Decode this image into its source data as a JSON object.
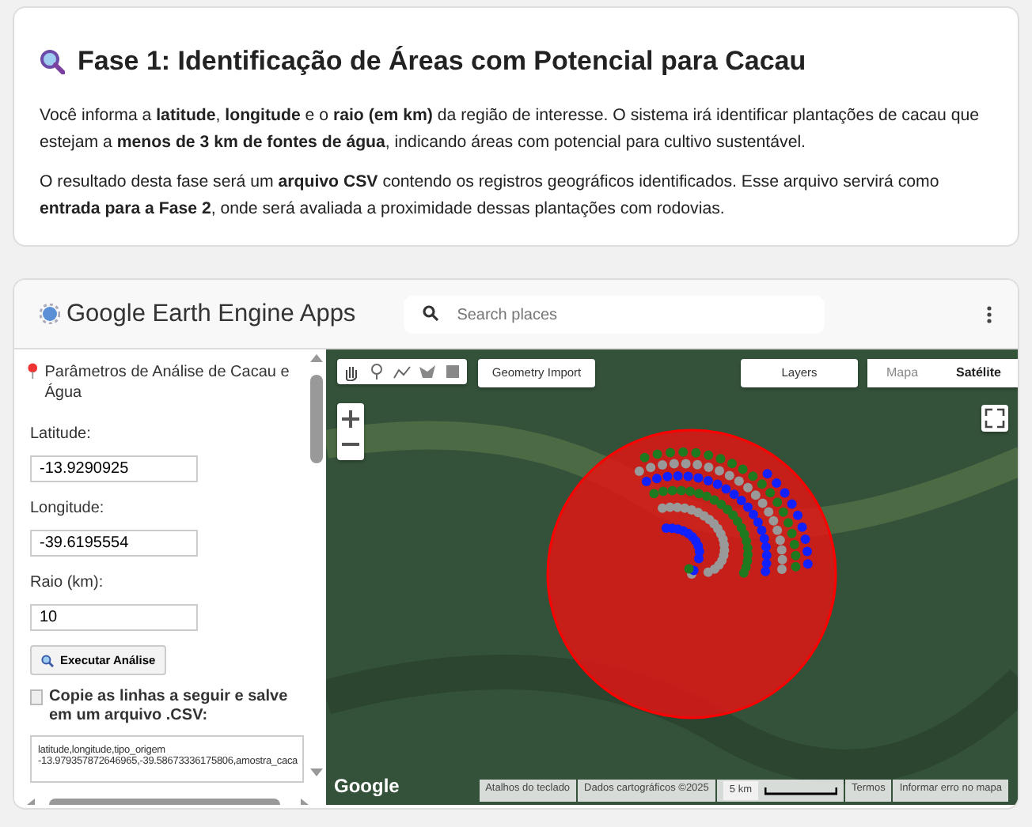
{
  "intro": {
    "title": "Fase 1: Identificação de Áreas com Potencial para Cacau",
    "paragraphs": [
      "Você informa a **latitude**, **longitude** e o **raio (em km)** da região de interesse. O sistema irá identificar plantações de cacau que estejam a **menos de 3 km de fontes de água**, indicando áreas com potencial para cultivo sustentável.",
      "O resultado desta fase será um **arquivo CSV** contendo os registros geográficos identificados. Esse arquivo servirá como **entrada para a Fase 2**, onde será avaliada a proximidade dessas plantações com rodovias."
    ]
  },
  "app": {
    "title": "Google Earth Engine Apps",
    "search": {
      "placeholder": "Search places"
    },
    "panel": {
      "heading": "Parâmetros de Análise de Cacau e Água",
      "fields": [
        {
          "label": "Latitude:",
          "value": "-13.9290925"
        },
        {
          "label": "Longitude:",
          "value": "-39.6195554"
        },
        {
          "label": "Raio (km):",
          "value": "10"
        }
      ],
      "button": "Executar Análise",
      "csv_heading": "Copie as linhas a seguir e salve em um arquivo .CSV:",
      "csv_lines": [
        "latitude,longitude,tipo_origem",
        "-13.979357872646965,-39.58673336175806,amostra_caca"
      ]
    },
    "map": {
      "geometry_button": "Geometry Import",
      "layers_button": "Layers",
      "map_types": [
        {
          "label": "Mapa",
          "selected": false
        },
        {
          "label": "Satélite",
          "selected": true
        }
      ],
      "logo": "Google",
      "attribution": [
        "Atalhos do teclado",
        "Dados cartográficos ©2025"
      ],
      "scale": "5 km",
      "links": [
        "Termos",
        "Informar erro no mapa"
      ]
    }
  }
}
